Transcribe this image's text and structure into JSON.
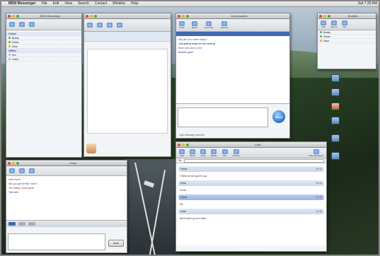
{
  "menubar": {
    "apple": "",
    "app": "MSN Messenger",
    "items": [
      "File",
      "Edit",
      "View",
      "Search",
      "Contact",
      "Window",
      "Help"
    ],
    "clock": "Sat 7:30 AM"
  },
  "contacts_window": {
    "title": "MSN Messenger",
    "groups": [
      {
        "name": "Online",
        "items": [
          "Buddy",
          "Fisher",
          "Dave"
        ]
      },
      {
        "name": "Offline",
        "items": [
          "Eric",
          "Gwen"
        ]
      }
    ],
    "footer": ""
  },
  "conversation_window": {
    "title": "Conversation",
    "toolbar": [
      "Invite",
      "Block",
      "Send File",
      "Send To"
    ],
    "lines": [
      "Hey are you online today?",
      "Just getting ready for the meeting",
      "Sure, see you in a bit",
      "Sounds good"
    ],
    "input_text": "",
    "send_label": "Send",
    "footer_status": "Last message received"
  },
  "ichat_window": {
    "title": "iChat",
    "lines": [
      "Hello there",
      "Did you get the file I sent?",
      "Yes thanks, looks great",
      "Talk later"
    ],
    "input_text": "",
    "send_label": "Send"
  },
  "chat_log_window": {
    "title": "Chat",
    "toolbar": [
      "Add",
      "Block",
      "Invite",
      "Buddy",
      "Info",
      "Smileys",
      "Hide Messages"
    ],
    "field_label": "To:",
    "entries": [
      {
        "who": "Fisher",
        "time": "10:31",
        "text": "I think we are good to go"
      },
      {
        "who": "Dave",
        "time": "10:32",
        "text": "Great"
      },
      {
        "who": "Fisher",
        "time": "10:33",
        "text": "Ok"
      },
      {
        "who": "Dave",
        "time": "10:35",
        "text": "We'll catch up on it later"
      }
    ]
  },
  "buddy_panel": {
    "title": "Buddies",
    "buttons": [
      "Add",
      "Search",
      "Info"
    ],
    "rows": [
      "Buddy",
      "Fisher",
      "Dave"
    ]
  },
  "desktop_icons": [
    "",
    "",
    "",
    "",
    "",
    ""
  ],
  "colors": {
    "accent": "#2a72c8",
    "online": "#4caf50",
    "away": "#e2b02a"
  }
}
